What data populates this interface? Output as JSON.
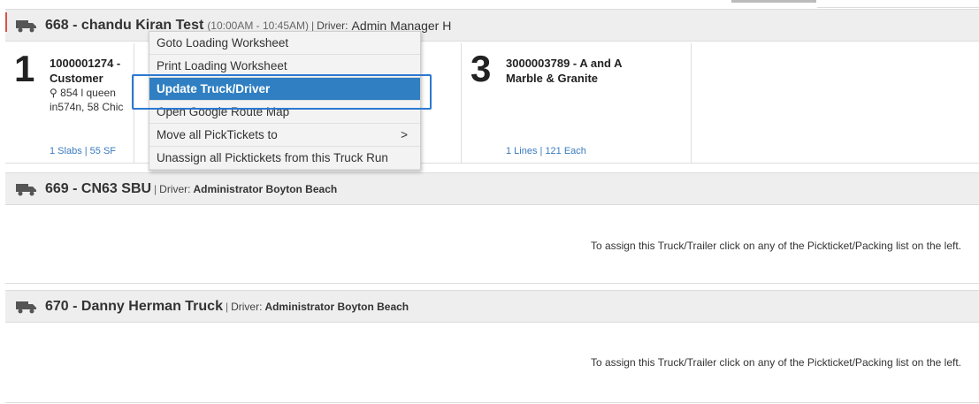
{
  "trucks": [
    {
      "title": "668 - chandu Kiran Test",
      "time_window": "(10:00AM - 10:45AM)",
      "driver_label": "Driver:",
      "driver_name": "Admin Manager H"
    },
    {
      "title": "669 - CN63 SBU",
      "driver_label": "Driver:",
      "driver_name": "Administrator Boyton Beach"
    },
    {
      "title": "670 - Danny Herman Truck",
      "driver_label": "Driver:",
      "driver_name": "Administrator Boyton Beach"
    }
  ],
  "stops": [
    {
      "number": "1",
      "line1": "1000001274 -",
      "line2": "Customer",
      "address1": "854 l queen",
      "address2": "in574n, 58 Chic",
      "meta": "1 Slabs | 55 SF"
    },
    {
      "number": "3",
      "line1": "3000003789 - A and A",
      "line2": "Marble & Granite",
      "meta": "1 Lines | 121 Each"
    }
  ],
  "assign_message": "To assign this Truck/Trailer click on any of the Pickticket/Packing list on the left.",
  "context_menu": {
    "items": [
      "Goto Loading Worksheet",
      "Print Loading Worksheet",
      "Update Truck/Driver",
      "Open Google Route Map",
      "Move all PickTickets to",
      "Unassign all Picktickets from this Truck Run"
    ],
    "selected_index": 2,
    "submenu_arrow": ">"
  },
  "colors": {
    "header_bg": "#eeeeee",
    "menu_selected": "#2f7fc2",
    "highlight_border": "#2b79d1",
    "meta_link": "#3a7bbf"
  }
}
